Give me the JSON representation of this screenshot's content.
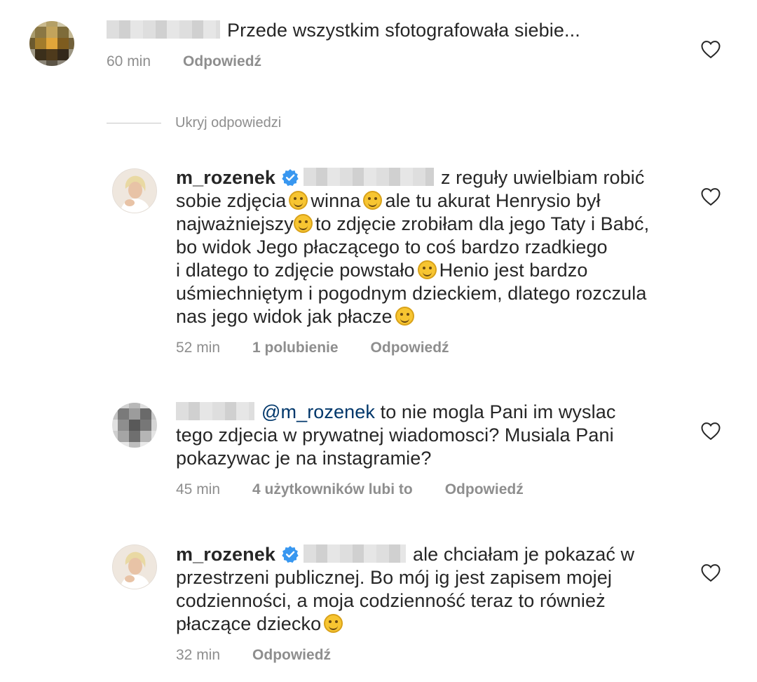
{
  "colors": {
    "text": "#262626",
    "meta": "#8e8e8e",
    "mention": "#00376b",
    "verified": "#3897f0"
  },
  "hide_replies": "Ukryj odpowiedzi",
  "comments": [
    {
      "username": "",
      "text": "Przede wszystkim sfotografowała siebie...",
      "time": "60 min",
      "likes": "",
      "reply": "Odpowiedź",
      "icon": "heart-outline-icon"
    },
    {
      "username": "m_rozenek",
      "verified": true,
      "line1": "z reguły uwielbiam robić",
      "line2a": "sobie zdjęcia",
      "line2b": "winna",
      "line2c": "ale tu akurat Henrysio był",
      "line3a": "najważniejszy",
      "line3b": "to zdjęcie zrobiłam dla jego Taty i Babć,",
      "line4": "bo widok Jego płaczącego to coś bardzo rzadkiego",
      "line5a": "i dlatego to zdjęcie powstało",
      "line5b": "Henio jest bardzo",
      "line6": "uśmiechniętym i pogodnym dzieckiem, dlatego rozczula",
      "line7": "nas jego widok jak płacze",
      "time": "52 min",
      "likes": "1 polubienie",
      "reply": "Odpowiedź",
      "icon": "heart-outline-icon"
    },
    {
      "username": "",
      "mention": "@m_rozenek",
      "line1": "to nie mogla Pani im wyslac",
      "line2": "tego zdjecia w prywatnej wiadomosci? Musiala Pani",
      "line3": "pokazywac je na instagramie?",
      "time": "45 min",
      "likes": "4 użytkowników lubi to",
      "reply": "Odpowiedź",
      "icon": "heart-outline-icon"
    },
    {
      "username": "m_rozenek",
      "verified": true,
      "line1": "ale chciałam je pokazać w",
      "line2": "przestrzeni publicznej. Bo mój ig jest zapisem mojej",
      "line3": "codzienności, a moja codzienność teraz to również",
      "line4": "płaczące dziecko",
      "time": "32 min",
      "likes": "",
      "reply": "Odpowiedź",
      "icon": "heart-outline-icon"
    }
  ]
}
